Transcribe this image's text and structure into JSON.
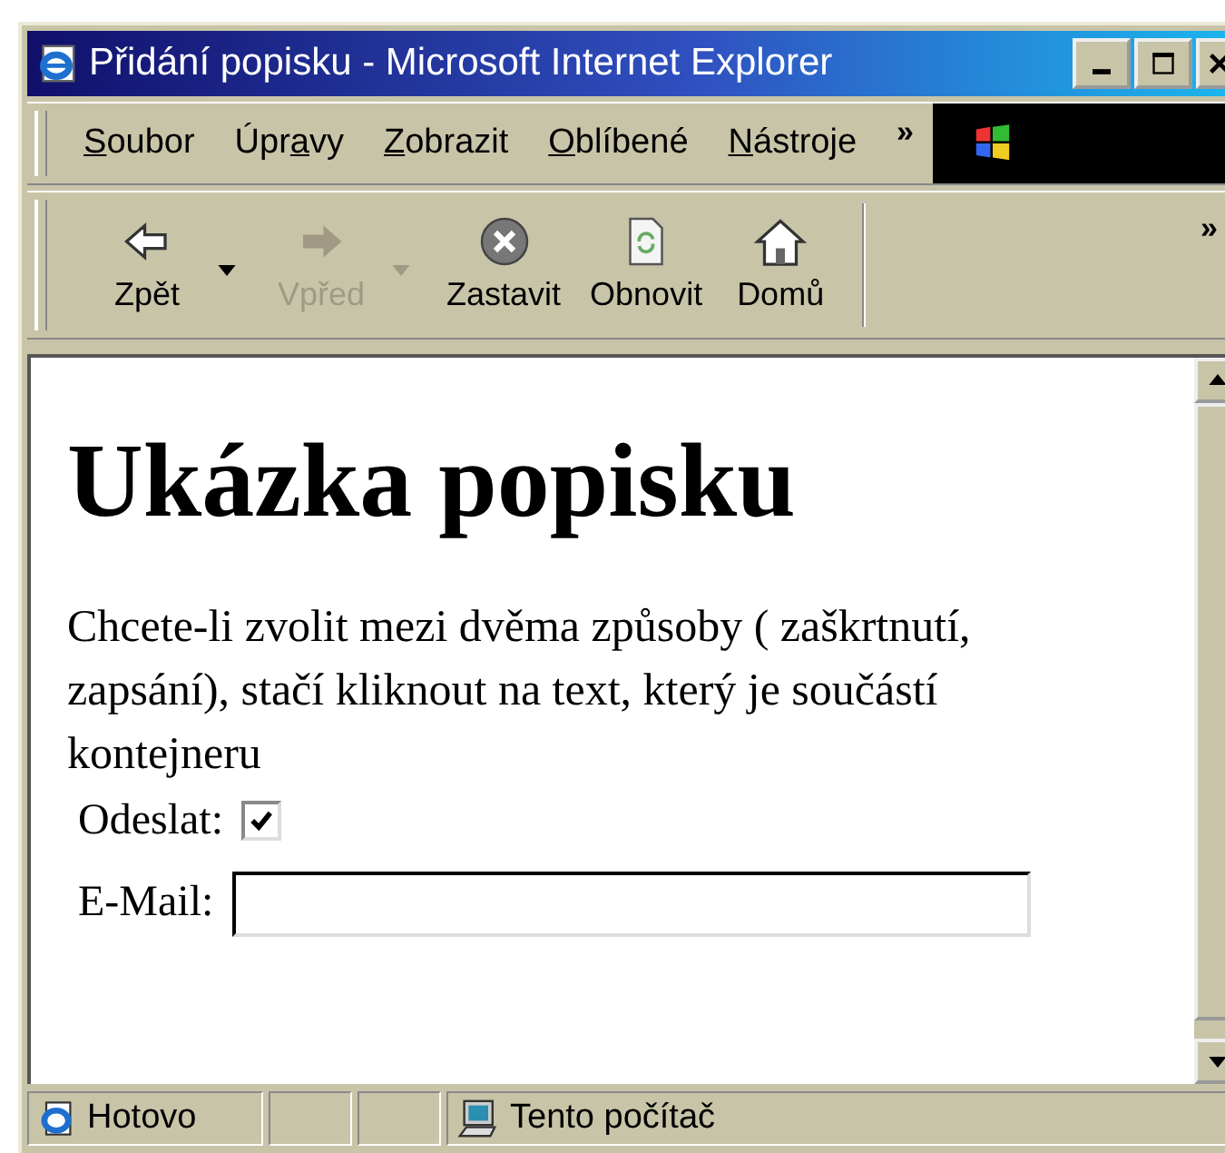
{
  "window": {
    "title": "Přidání popisku - Microsoft Internet Explorer"
  },
  "menu": [
    {
      "key": "S",
      "post": "oubor"
    },
    {
      "pre": "Úpr",
      "key": "a",
      "post": "vy"
    },
    {
      "key": "Z",
      "post": "obrazit"
    },
    {
      "key": "O",
      "post": "blíbené"
    },
    {
      "key": "N",
      "post": "ástroje"
    }
  ],
  "menu_more": "»",
  "toolbar": [
    {
      "kind": "back",
      "label": "Zpět",
      "disabled": false,
      "dropdown": true
    },
    {
      "kind": "forward",
      "label": "Vpřed",
      "disabled": true,
      "dropdown": true
    },
    {
      "kind": "stop",
      "label": "Zastavit",
      "disabled": false,
      "dropdown": false
    },
    {
      "kind": "refresh",
      "label": "Obnovit",
      "disabled": false,
      "dropdown": false
    },
    {
      "kind": "home",
      "label": "Domů",
      "disabled": false,
      "dropdown": false
    }
  ],
  "toolbar_more": "»",
  "page": {
    "heading": "Ukázka popisku",
    "paragraph": "Chcete-li zvolit mezi dvěma způsoby ( zaškrtnutí, zapsání), stačí kliknout na text, který je součástí kontejneru",
    "checkbox": {
      "label": "Odeslat:",
      "checked": true
    },
    "email": {
      "label": "E-Mail:"
    }
  },
  "status_bar": {
    "text": "Hotovo",
    "zone": "Tento počítač"
  }
}
